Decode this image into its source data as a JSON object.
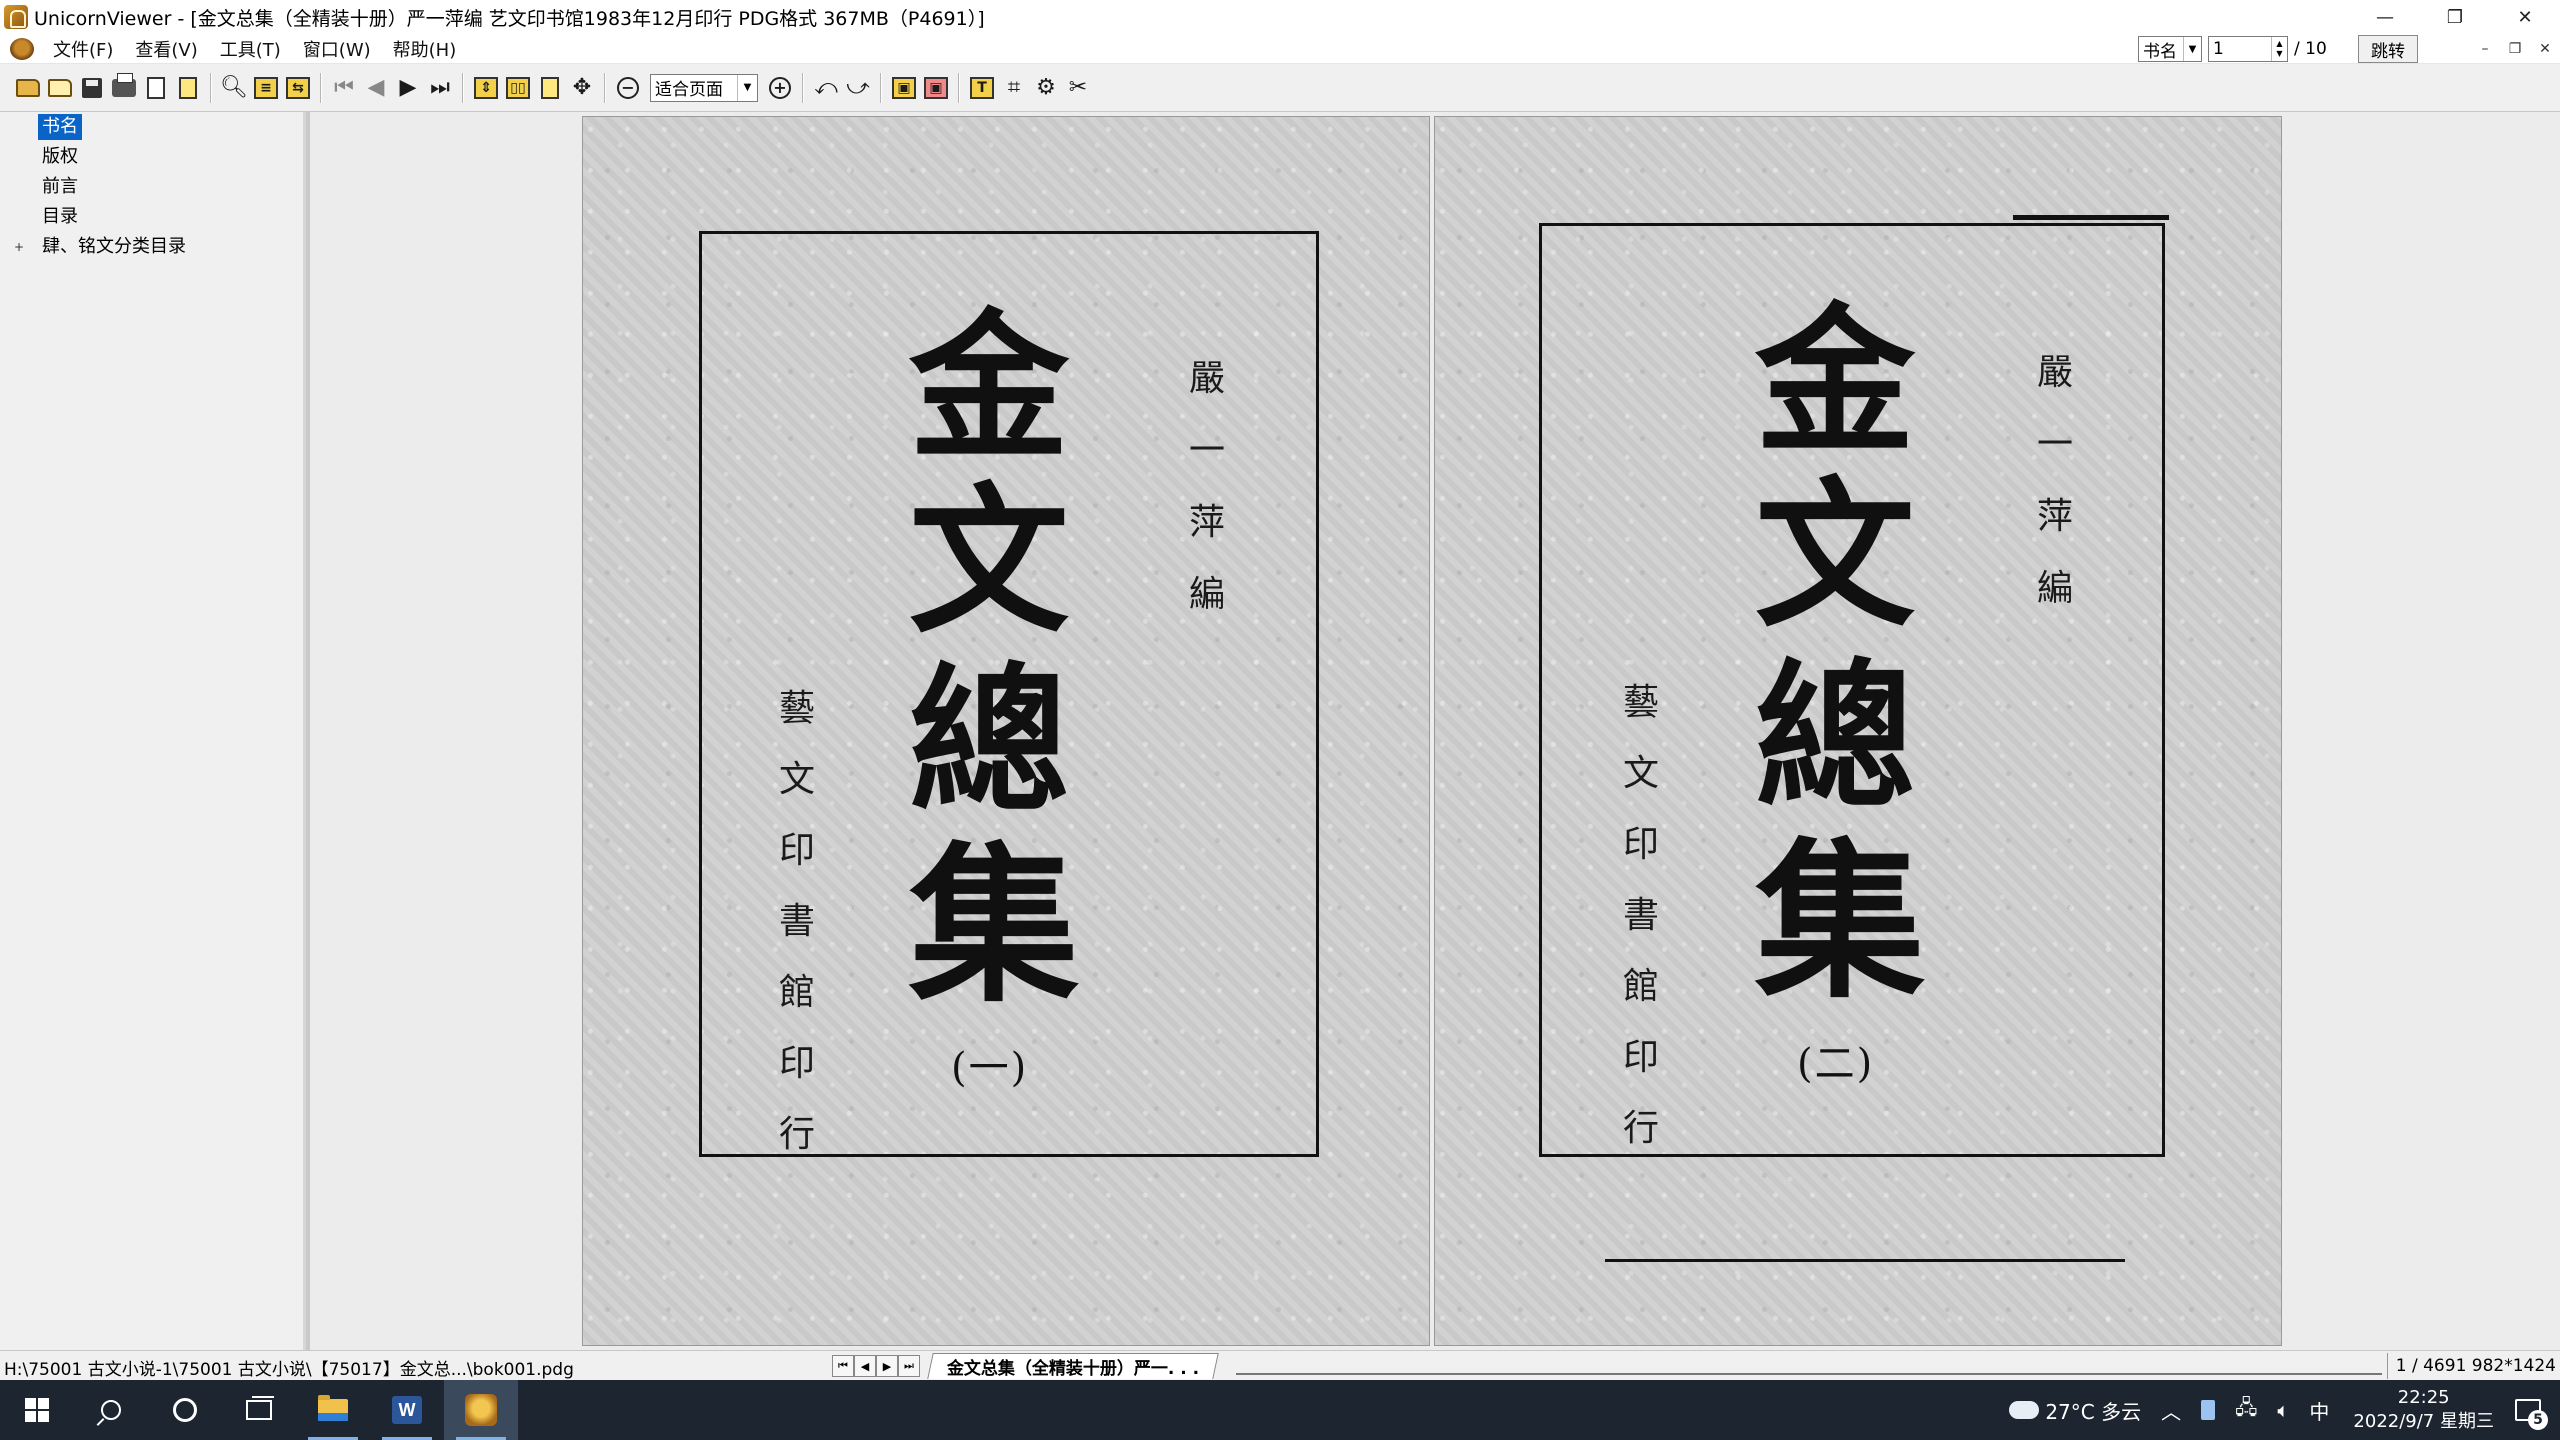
{
  "window": {
    "title": "UnicornViewer - [金文总集（全精装十册）严一萍编 艺文印书馆1983年12月印行 PDG格式 367MB（P4691）]",
    "minimize_glyph": "—",
    "restore_glyph": "❐",
    "close_glyph": "✕"
  },
  "menu": {
    "items": [
      "文件(F)",
      "查看(V)",
      "工具(T)",
      "窗口(W)",
      "帮助(H)"
    ]
  },
  "nav": {
    "section_value": "书名",
    "page_value": "1",
    "total_label": "/ 10",
    "jump_label": "跳转"
  },
  "toolbar": {
    "zoom_value": "适合页面"
  },
  "tree": {
    "items": [
      {
        "label": "书名",
        "selected": true
      },
      {
        "label": "版权",
        "selected": false
      },
      {
        "label": "前言",
        "selected": false
      },
      {
        "label": "目录",
        "selected": false
      },
      {
        "label": "肆、铭文分类目录",
        "selected": false,
        "expandable": true
      }
    ],
    "expander_glyph": "+"
  },
  "pages": [
    {
      "title_chars": [
        "金",
        "文",
        "總",
        "集"
      ],
      "editor_chars": [
        "嚴",
        "一",
        "萍",
        "編"
      ],
      "publisher_chars": [
        "藝",
        "文",
        "印",
        "書",
        "館",
        "印",
        "行"
      ],
      "volume": "(一)"
    },
    {
      "title_chars": [
        "金",
        "文",
        "總",
        "集"
      ],
      "editor_chars": [
        "嚴",
        "一",
        "萍",
        "編"
      ],
      "publisher_chars": [
        "藝",
        "文",
        "印",
        "書",
        "館",
        "印",
        "行"
      ],
      "volume": "(二)"
    }
  ],
  "status": {
    "path": "H:\\75001 古文小说-1\\75001 古文小说\\【75017】金文总...\\bok001.pdg",
    "tab_label": "金文总集（全精装十册）严一. . .",
    "page_info": "1 / 4691 982*1424"
  },
  "taskbar": {
    "weather": "27°C 多云",
    "ime": "中",
    "time": "22:25",
    "date": "2022/9/7 星期三",
    "notification_count": "5"
  }
}
